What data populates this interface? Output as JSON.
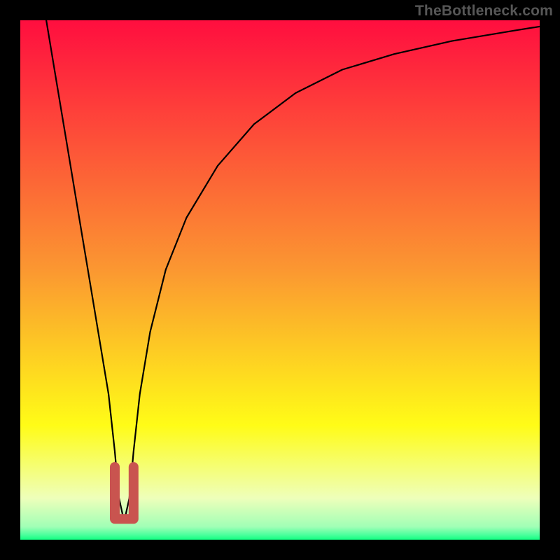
{
  "watermark": "TheBottleneck.com",
  "colors": {
    "grad_top": "#ff0e3f",
    "grad_mid_orange": "#fb9731",
    "grad_yellow": "#fffc17",
    "grad_pale": "#eeffba",
    "grad_lightgreen": "#a1ffb6",
    "grad_green2": "#4fff9e",
    "grad_green": "#12ff82",
    "marker": "#c9544f",
    "line": "#000000"
  },
  "chart_data": {
    "type": "line",
    "title": "",
    "xlabel": "",
    "ylabel": "",
    "xlim": [
      0,
      100
    ],
    "ylim": [
      0,
      100
    ],
    "notes": "Bottleneck-style heat gradient. Black curve shows deviation from optimal; minimum ≈ x=20. No axis ticks or labels are rendered on screen.",
    "series": [
      {
        "name": "bottleneck-curve",
        "x": [
          5,
          7,
          9,
          11,
          13,
          15,
          17,
          18.2,
          19,
          20,
          21,
          21.8,
          23,
          25,
          28,
          32,
          38,
          45,
          53,
          62,
          72,
          83,
          95,
          100
        ],
        "y": [
          100,
          88,
          76,
          64,
          52,
          40,
          28,
          17,
          8,
          3.5,
          8,
          17,
          28,
          40,
          52,
          62,
          72,
          80,
          86,
          90.5,
          93.5,
          96,
          98,
          98.8
        ]
      }
    ],
    "marker": {
      "x_range": [
        18.2,
        21.8
      ],
      "y_approx": 4,
      "label": "optimal-region"
    }
  }
}
